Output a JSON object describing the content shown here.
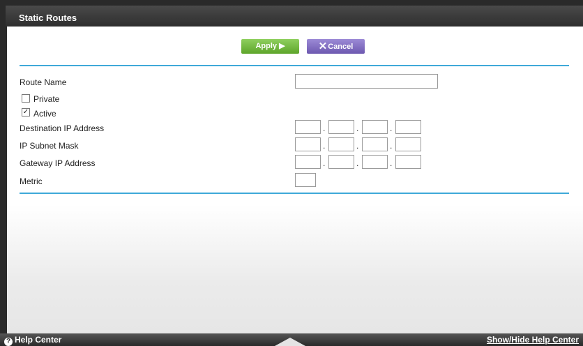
{
  "header": {
    "title": "Static Routes"
  },
  "buttons": {
    "apply": "Apply ▶",
    "cancel_icon": "✕",
    "cancel": "Cancel"
  },
  "form": {
    "route_name": {
      "label": "Route Name",
      "value": ""
    },
    "private": {
      "label": "Private",
      "checked": false
    },
    "active": {
      "label": "Active",
      "checked": true,
      "mark": "✓"
    },
    "destination_ip": {
      "label": "Destination IP Address"
    },
    "subnet_mask": {
      "label": "IP Subnet Mask"
    },
    "gateway_ip": {
      "label": "Gateway IP Address"
    },
    "metric": {
      "label": "Metric"
    }
  },
  "footer": {
    "help_icon": "?",
    "help_center": "Help Center",
    "show_hide": "Show/Hide Help Center"
  }
}
